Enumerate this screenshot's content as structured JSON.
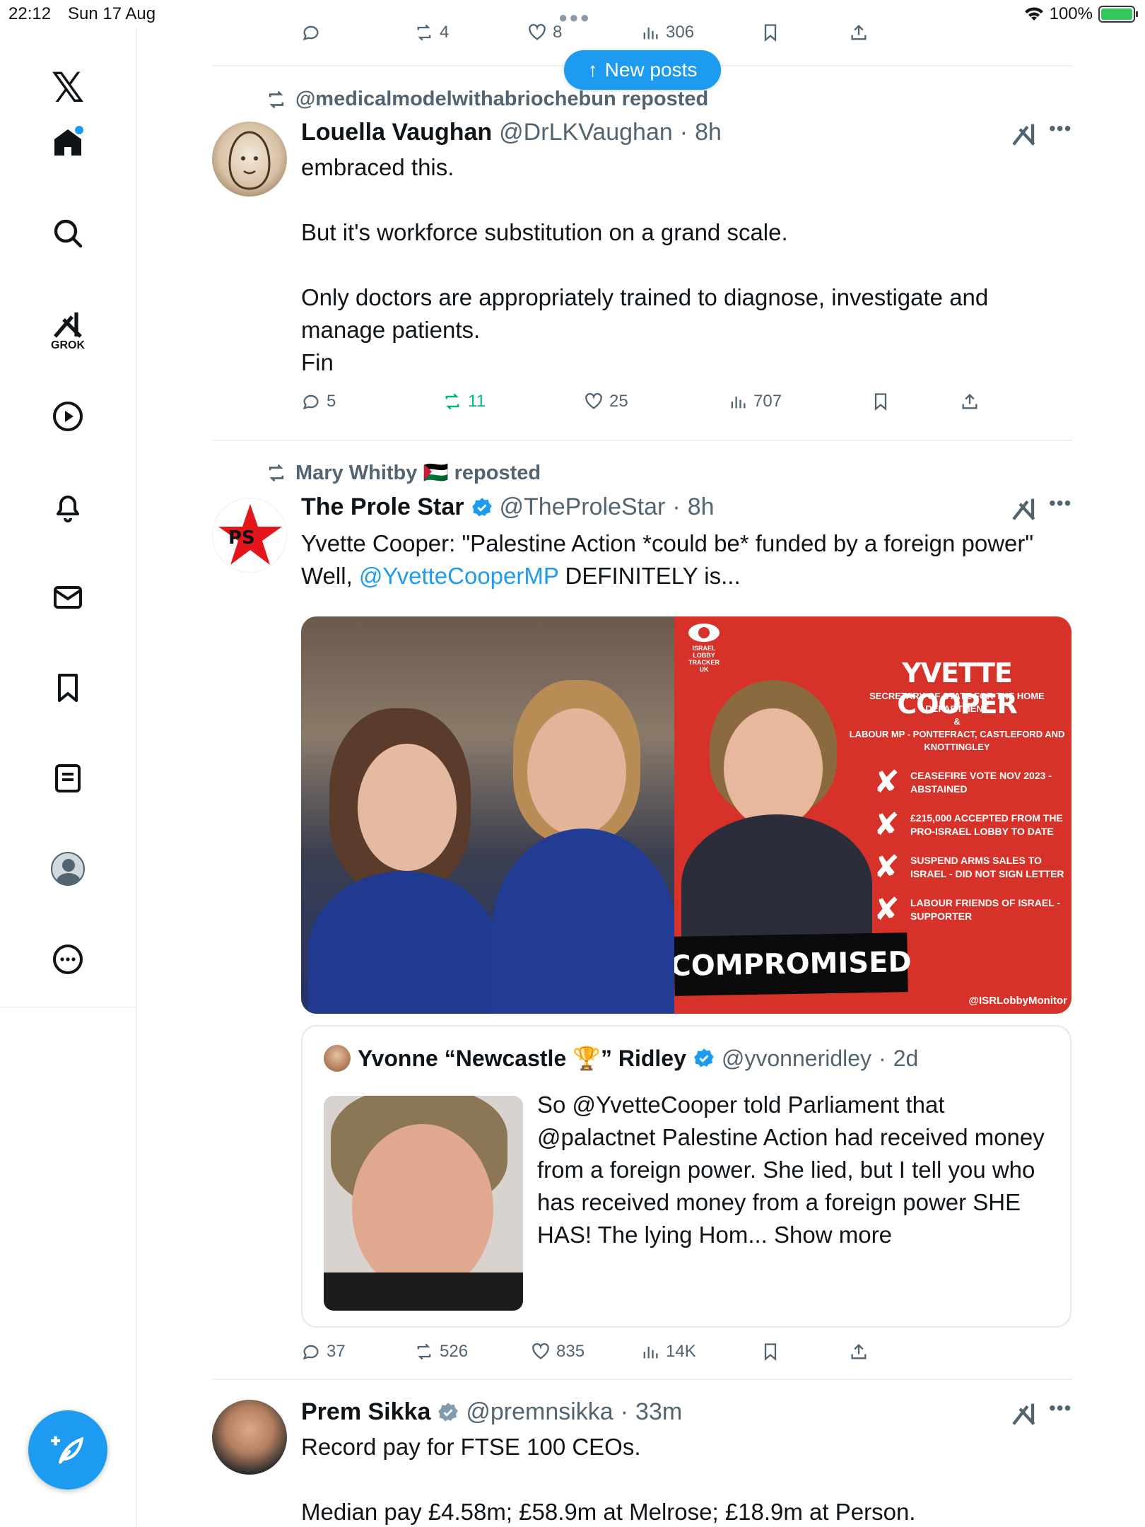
{
  "status": {
    "time": "22:12",
    "date": "Sun 17 Aug",
    "battery": "100%"
  },
  "nav": {
    "grok_label": "GROK"
  },
  "new_posts": "New posts",
  "top_actions": {
    "reposts": "4",
    "likes": "8",
    "views": "306"
  },
  "tweets": [
    {
      "repost_by": "@medicalmodelwithabriochebun reposted",
      "name": "Louella Vaughan",
      "handle": "@DrLKVaughan",
      "time": "8h",
      "body": "embraced this.\n\nBut it's workforce substitution on a grand scale.\n\nOnly doctors are appropriately trained to diagnose, investigate and manage patients.\nFin",
      "replies": "5",
      "reposts": "11",
      "likes": "25",
      "views": "707"
    },
    {
      "repost_by": "Mary Whitby 🇵🇸 reposted",
      "name": "The Prole Star",
      "handle": "@TheProleStar",
      "time": "8h",
      "body_line1": "Yvette Cooper: \"Palestine Action *could be* funded by a foreign power\"",
      "body_prefix": "Well, ",
      "body_mention": "@YvetteCooperMP",
      "body_suffix": " DEFINITELY is...",
      "image": {
        "logo_text": "ISRAEL LOBBY TRACKER UK",
        "title": "YVETTE COOPER",
        "subtitle": "SECRETARY OF STATE FOR THE HOME DEPARTMENT\n&\nLABOUR MP - PONTEFRACT, CASTLEFORD AND KNOTTINGLEY",
        "items": [
          "CEASEFIRE VOTE NOV 2023 - ABSTAINED",
          "£215,000 ACCEPTED FROM THE PRO-ISRAEL LOBBY TO DATE",
          "SUSPEND ARMS SALES TO ISRAEL - DID NOT SIGN LETTER",
          "LABOUR FRIENDS OF ISRAEL - SUPPORTER"
        ],
        "stamp": "COMPROMISED",
        "credit": "@ISRLobbyMonitor"
      },
      "quote": {
        "name": "Yvonne “Newcastle 🏆” Ridley",
        "handle": "@yvonneridley",
        "time": "2d",
        "text": "So @YvetteCooper told Parliament that @palactnet Palestine Action had received money from a foreign power. She lied, but I tell you who has received money from a foreign power SHE HAS! The lying Hom...",
        "show_more": "Show more"
      },
      "replies": "37",
      "reposts": "526",
      "likes": "835",
      "views": "14K"
    },
    {
      "name": "Prem Sikka",
      "handle": "@premnsikka",
      "time": "33m",
      "body": "Record pay for FTSE 100 CEOs.\n\nMedian pay £4.58m; £58.9m at Melrose; £18.9m at Person."
    }
  ]
}
